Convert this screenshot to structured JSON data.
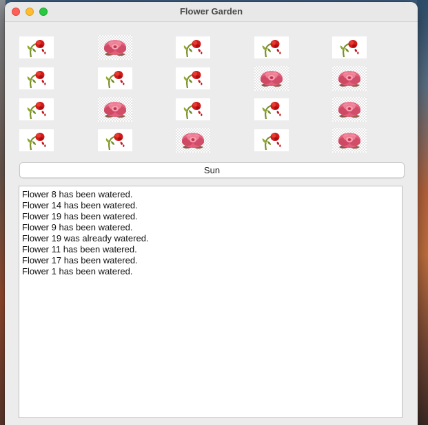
{
  "window": {
    "title": "Flower Garden"
  },
  "garden": {
    "rows": [
      [
        "wilted",
        "bloom",
        "wilted",
        "wilted",
        "wilted"
      ],
      [
        "wilted",
        "wilted",
        "wilted",
        "bloom",
        "bloom"
      ],
      [
        "wilted",
        "bloom",
        "wilted",
        "wilted",
        "bloom"
      ],
      [
        "wilted",
        "wilted",
        "bloom",
        "wilted",
        "bloom"
      ]
    ]
  },
  "controls": {
    "sun_label": "Sun"
  },
  "log": {
    "lines": [
      "Flower 8 has been watered.",
      "Flower 14 has been watered.",
      "Flower 19 has been watered.",
      "Flower 9 has been watered.",
      "Flower 19 was already watered.",
      "Flower 11 has been watered.",
      "Flower 17 has been watered.",
      "Flower 1 has been watered."
    ]
  },
  "icons": {
    "wilted": "wilted-flower-icon",
    "bloom": "blooming-rose-icon"
  },
  "colors": {
    "close": "#fe5f57",
    "minimize": "#febc2e",
    "maximize": "#28c840"
  }
}
